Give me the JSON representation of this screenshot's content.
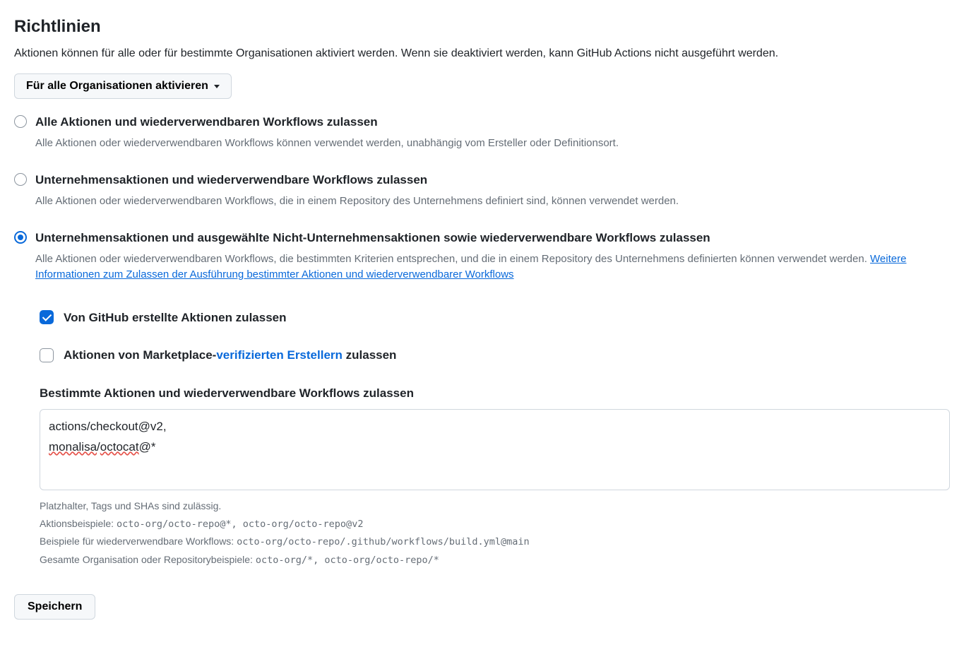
{
  "heading": "Richtlinien",
  "description": "Aktionen können für alle oder für bestimmte Organisationen aktiviert werden. Wenn sie deaktiviert werden, kann GitHub Actions nicht ausgeführt werden.",
  "dropdown": {
    "label": "Für alle Organisationen aktivieren"
  },
  "policies": {
    "option1": {
      "title": "Alle Aktionen und wiederverwendbaren Workflows zulassen",
      "desc": "Alle Aktionen oder wiederverwendbaren Workflows können verwendet werden, unabhängig vom Ersteller oder Definitionsort."
    },
    "option2": {
      "title": "Unternehmensaktionen und wiederverwendbare Workflows zulassen",
      "desc": "Alle Aktionen oder wiederverwendbaren Workflows, die in einem Repository des Unternehmens definiert sind, können verwendet werden."
    },
    "option3": {
      "title": "Unternehmensaktionen und ausgewählte Nicht-Unternehmensaktionen sowie wiederverwendbare Workflows zulassen",
      "desc_prefix": "Alle Aktionen oder wiederverwendbaren Workflows, die bestimmten Kriterien entsprechen, und die in einem Repository des Unternehmens definierten können verwendet werden. ",
      "desc_link": "Weitere Informationen zum Zulassen der Ausführung bestimmter Aktionen und wiederverwendbarer Workflows"
    }
  },
  "sub": {
    "allow_github": "Von GitHub erstellte Aktionen zulassen",
    "allow_marketplace_prefix": "Aktionen von Marketplace-",
    "allow_marketplace_link": "verifizierten Erstellern",
    "allow_marketplace_suffix": " zulassen",
    "specific_title": "Bestimmte Aktionen und wiederverwendbare Workflows zulassen",
    "textarea_line1": "actions/checkout@v2,",
    "textarea_line2_a": "monalisa",
    "textarea_line2_sep": "/",
    "textarea_line2_b": "octocat",
    "textarea_line2_suffix": "@*"
  },
  "helper": {
    "line1": "Platzhalter, Tags und SHAs sind zulässig.",
    "line2_label": "Aktionsbeispiele: ",
    "line2_code": "octo-org/octo-repo@*, octo-org/octo-repo@v2",
    "line3_label": "Beispiele für wiederverwendbare Workflows: ",
    "line3_code": "octo-org/octo-repo/.github/workflows/build.yml@main",
    "line4_label": "Gesamte Organisation oder Repositorybeispiele: ",
    "line4_code": "octo-org/*, octo-org/octo-repo/*"
  },
  "save_button": "Speichern"
}
